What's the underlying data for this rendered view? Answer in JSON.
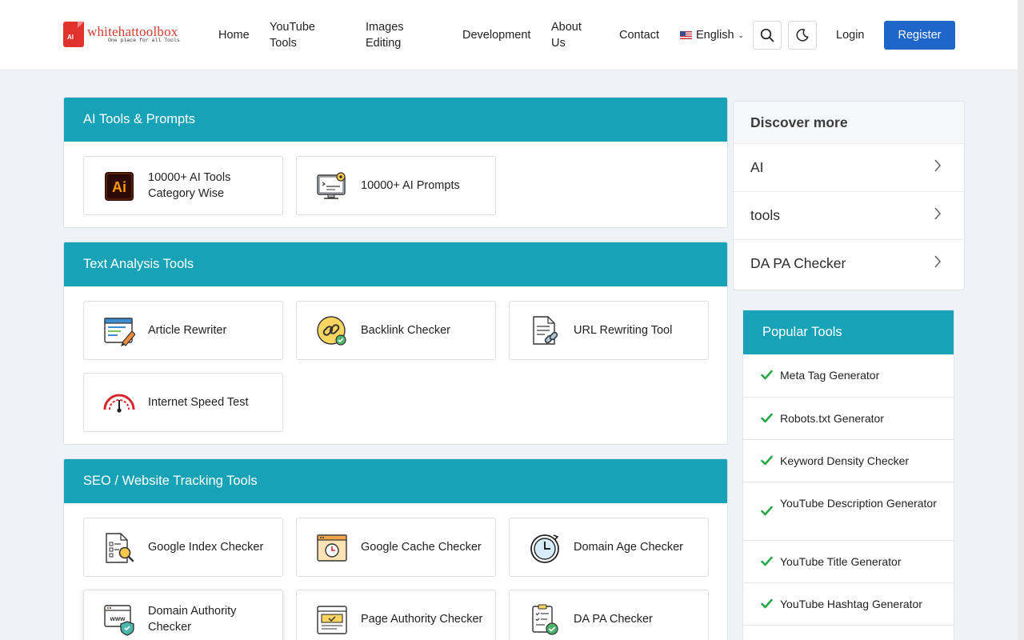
{
  "brand": {
    "logo_badge": "AI",
    "name": "whitehattoolbox",
    "tagline": "One place for all Tools"
  },
  "nav": {
    "home": "Home",
    "youtube_1": "YouTube",
    "youtube_2": "Tools",
    "images_1": "Images",
    "images_2": "Editing",
    "development": "Development",
    "about_1": "About",
    "about_2": "Us",
    "contact": "Contact",
    "language": "English",
    "login": "Login",
    "register": "Register"
  },
  "sections": [
    {
      "title": "AI Tools & Prompts",
      "tools": [
        {
          "label": "10000+ AI Tools Category Wise",
          "icon": "ai-icon"
        },
        {
          "label": "10000+ AI Prompts",
          "icon": "ai-prompts-icon"
        }
      ]
    },
    {
      "title": "Text Analysis Tools",
      "tools": [
        {
          "label": "Article Rewriter",
          "icon": "article-rewriter-icon"
        },
        {
          "label": "Backlink Checker",
          "icon": "backlink-checker-icon"
        },
        {
          "label": "URL Rewriting Tool",
          "icon": "url-rewriting-icon"
        },
        {
          "label": "Internet Speed Test",
          "icon": "speed-test-icon"
        }
      ]
    },
    {
      "title": "SEO / Website Tracking Tools",
      "tools": [
        {
          "label": "Google Index Checker",
          "icon": "google-index-icon"
        },
        {
          "label": "Google Cache Checker",
          "icon": "google-cache-icon"
        },
        {
          "label": "Domain Age Checker",
          "icon": "domain-age-icon"
        },
        {
          "label": "Domain Authority Checker",
          "icon": "domain-authority-icon"
        },
        {
          "label": "Page Authority Checker",
          "icon": "page-authority-icon"
        },
        {
          "label": "DA PA Checker",
          "icon": "da-pa-icon"
        }
      ]
    }
  ],
  "discover": {
    "title": "Discover more",
    "items": [
      "AI",
      "tools",
      "DA PA Checker"
    ]
  },
  "popular": {
    "title": "Popular Tools",
    "items": [
      "Meta Tag Generator",
      "Robots.txt Generator",
      "Keyword Density Checker",
      "YouTube Description Generator",
      "YouTube Title Generator",
      "YouTube Hashtag Generator"
    ]
  },
  "colors": {
    "section_header": "#17a2b8",
    "register_button": "#1e66c8",
    "check": "#28a745",
    "logo_red": "#d63a2f"
  }
}
